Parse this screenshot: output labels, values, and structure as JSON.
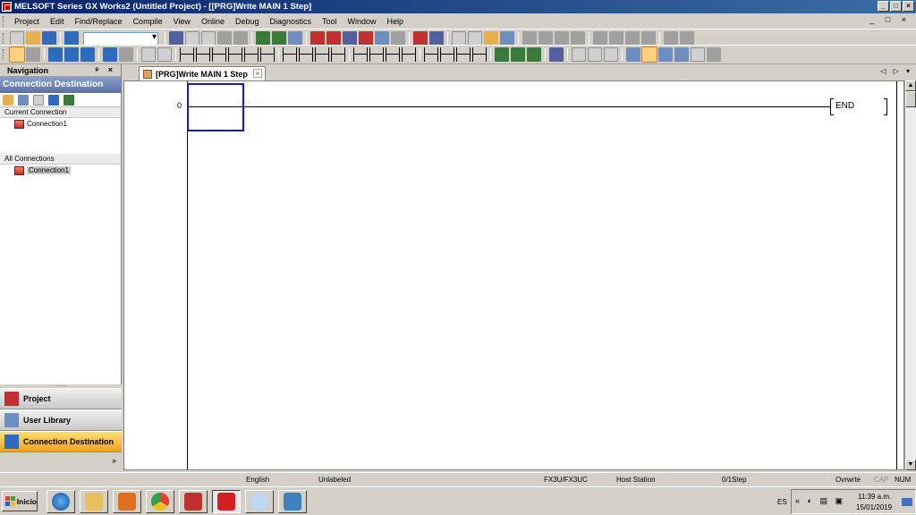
{
  "window": {
    "title": "MELSOFT Series GX Works2 (Untitled Project) - [[PRG]Write MAIN 1 Step]",
    "controls": [
      "_",
      "□",
      "×"
    ]
  },
  "menubar": {
    "items": [
      "Project",
      "Edit",
      "Find/Replace",
      "Compile",
      "View",
      "Online",
      "Debug",
      "Diagnostics",
      "Tool",
      "Window",
      "Help"
    ],
    "mdi_controls": "_ □ ×"
  },
  "navigation": {
    "title": "Navigation",
    "header_controls": "ᵖ ×",
    "section_title": "Connection Destination",
    "current_label": "Current Connection",
    "current_item": "Connection1",
    "all_label": "All Connections",
    "all_item": "Connection1",
    "splitter": "........",
    "buttons": [
      "Project",
      "User Library",
      "Connection Destination"
    ],
    "more": "»"
  },
  "editor": {
    "tab_label": "[PRG]Write MAIN 1 Step",
    "tab_close": "×",
    "tab_nav": "◁ ▷ ▾",
    "rung_number": "0",
    "end_label": "END"
  },
  "statusbar": {
    "language": "English",
    "label": "Unlabeled",
    "plc_type": "FX3U/FX3UC",
    "station": "Host Station",
    "steps": "0/1Step",
    "mode": "Ovrwrte",
    "cap": "CAP",
    "num": "NUM"
  },
  "taskbar": {
    "start_label": "Inicio",
    "language": "ES",
    "tray_icons": "« ◐ ▤ ▣",
    "time": "11:39 a.m.",
    "date": "15/01/2019"
  },
  "colors": {
    "title_bar": "#0a246a",
    "cursor_box": "#1a1ab0",
    "active_nav_button": "#f0a020"
  }
}
